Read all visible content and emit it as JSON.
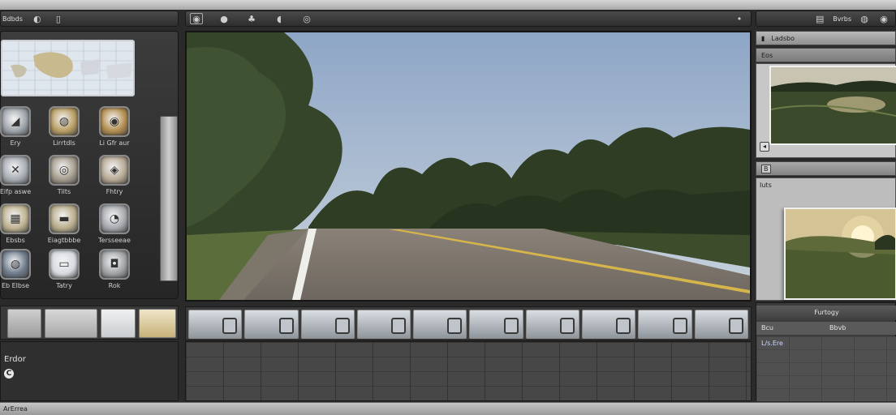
{
  "left_toolbar": {
    "label": "Bdbds"
  },
  "left_panel": {
    "effects": [
      {
        "label": "Ery",
        "accent": "#9ea4ab"
      },
      {
        "label": "Lirrtdls",
        "accent": "#b99e63"
      },
      {
        "label": "Li Gfr aur",
        "accent": "#b38e4f"
      },
      {
        "label": "Eifp aswe",
        "accent": "#a6acb2"
      },
      {
        "label": "Tilts",
        "accent": "#a49c8d"
      },
      {
        "label": "Fhtry",
        "accent": "#b7aa95"
      },
      {
        "label": "Ebsbs",
        "accent": "#bfb391"
      },
      {
        "label": "Eiagtbbbe",
        "accent": "#b9ad8b"
      },
      {
        "label": "Tersseeae",
        "accent": "#a5a9ad"
      },
      {
        "label": "Eb Elbse",
        "accent": "#6d7a8a"
      },
      {
        "label": "Tatry",
        "accent": "#d7dbe0"
      },
      {
        "label": "Rok",
        "accent": "#9fa3a6"
      }
    ]
  },
  "left_info": {
    "label": "Erdor",
    "icon_text": "C"
  },
  "right_panel": {
    "toolbar_label": "Bvrbs",
    "header1": "Ladsbo",
    "header2": "Eos",
    "header3": "B",
    "subheader": "Iuts",
    "panel_b_title": "Furtogy",
    "panel_b_row": "Bcu",
    "panel_b_row_right": "Bbvb",
    "panel_b_body_text": "L/s.Ere"
  },
  "statusbar": {
    "text": "ArErrea"
  },
  "colors": {
    "panel_dark": "#262626",
    "toolbar": "#3a3a3a",
    "sky": "#aab8cc",
    "road": "#777068"
  }
}
